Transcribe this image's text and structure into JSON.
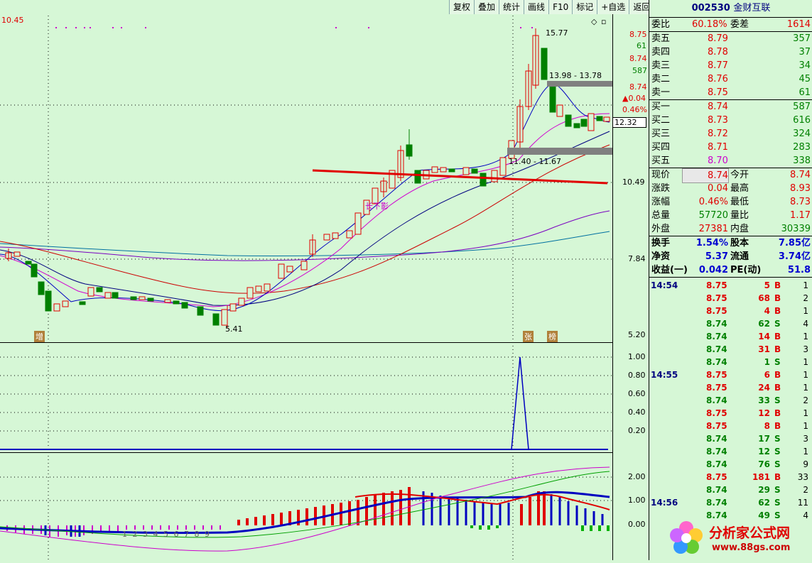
{
  "toolbar": {
    "buttons": [
      "复权",
      "叠加",
      "统计",
      "画线",
      "F10",
      "标记",
      "+自选",
      "返回"
    ]
  },
  "chart": {
    "top_price": "10.45",
    "high_label": "15.77",
    "low_label": "5.41",
    "zone_label_1": "13.98 - 13.78",
    "zone_label_2": "11.40 - 11.67",
    "annotation": "长下影",
    "marker_1": "增",
    "marker_2": "张",
    "marker_3": "榜",
    "axis_main": [
      "10.49",
      "7.84",
      "5.20"
    ],
    "axis_right_top": [
      "8.75",
      "61",
      "8.74",
      "587",
      "8.74",
      "▲0.04",
      "0.46%"
    ],
    "cursor_value": "12.32",
    "axis_mid": [
      "1.00",
      "0.80",
      "0.60",
      "0.40",
      "0.20"
    ],
    "axis_low": [
      "2.00",
      "1.00",
      "0.00"
    ],
    "bottom_digits": "1 2 3 4 5 6 7 8 9"
  },
  "panel": {
    "code": "002530",
    "name": "金财互联",
    "weibi": {
      "label": "委比",
      "value": "60.18%",
      "label2": "委差",
      "value2": "1614"
    },
    "sell": [
      {
        "label": "卖五",
        "price": "8.79",
        "vol": "357"
      },
      {
        "label": "卖四",
        "price": "8.78",
        "vol": "37"
      },
      {
        "label": "卖三",
        "price": "8.77",
        "vol": "34"
      },
      {
        "label": "卖二",
        "price": "8.76",
        "vol": "45"
      },
      {
        "label": "卖一",
        "price": "8.75",
        "vol": "61"
      }
    ],
    "buy": [
      {
        "label": "买一",
        "price": "8.74",
        "vol": "587"
      },
      {
        "label": "买二",
        "price": "8.73",
        "vol": "616"
      },
      {
        "label": "买三",
        "price": "8.72",
        "vol": "324"
      },
      {
        "label": "买四",
        "price": "8.71",
        "vol": "283"
      },
      {
        "label": "买五",
        "price": "8.70",
        "vol": "338"
      }
    ],
    "stats": [
      {
        "l1": "现价",
        "v1": "8.74",
        "l2": "今开",
        "v2": "8.74"
      },
      {
        "l1": "涨跌",
        "v1": "0.04",
        "l2": "最高",
        "v2": "8.93"
      },
      {
        "l1": "涨幅",
        "v1": "0.46%",
        "l2": "最低",
        "v2": "8.73"
      },
      {
        "l1": "总量",
        "v1": "57720",
        "l2": "量比",
        "v2": "1.17"
      },
      {
        "l1": "外盘",
        "v1": "27381",
        "l2": "内盘",
        "v2": "30339"
      }
    ],
    "stats2": [
      {
        "l1": "换手",
        "v1": "1.54%",
        "l2": "股本",
        "v2": "7.85亿"
      },
      {
        "l1": "净资",
        "v1": "5.37",
        "l2": "流通",
        "v2": "3.74亿"
      },
      {
        "l1": "收益(一)",
        "v1": "0.042",
        "l2": "PE(动)",
        "v2": "51.8"
      }
    ],
    "ticks": [
      {
        "t": "14:54",
        "p": "8.75",
        "v": "5",
        "s": "B",
        "n": "1"
      },
      {
        "t": "",
        "p": "8.75",
        "v": "68",
        "s": "B",
        "n": "2"
      },
      {
        "t": "",
        "p": "8.75",
        "v": "4",
        "s": "B",
        "n": "1"
      },
      {
        "t": "",
        "p": "8.74",
        "v": "62",
        "s": "S",
        "n": "4"
      },
      {
        "t": "",
        "p": "8.74",
        "v": "14",
        "s": "B",
        "n": "1"
      },
      {
        "t": "",
        "p": "8.74",
        "v": "31",
        "s": "B",
        "n": "3"
      },
      {
        "t": "",
        "p": "8.74",
        "v": "1",
        "s": "S",
        "n": "1"
      },
      {
        "t": "14:55",
        "p": "8.75",
        "v": "6",
        "s": "B",
        "n": "1"
      },
      {
        "t": "",
        "p": "8.75",
        "v": "24",
        "s": "B",
        "n": "1"
      },
      {
        "t": "",
        "p": "8.74",
        "v": "33",
        "s": "S",
        "n": "2"
      },
      {
        "t": "",
        "p": "8.75",
        "v": "12",
        "s": "B",
        "n": "1"
      },
      {
        "t": "",
        "p": "8.75",
        "v": "8",
        "s": "B",
        "n": "1"
      },
      {
        "t": "",
        "p": "8.74",
        "v": "17",
        "s": "S",
        "n": "3"
      },
      {
        "t": "",
        "p": "8.74",
        "v": "12",
        "s": "S",
        "n": "1"
      },
      {
        "t": "",
        "p": "8.74",
        "v": "76",
        "s": "S",
        "n": "9"
      },
      {
        "t": "",
        "p": "8.75",
        "v": "181",
        "s": "B",
        "n": "33"
      },
      {
        "t": "",
        "p": "8.74",
        "v": "29",
        "s": "S",
        "n": "2"
      },
      {
        "t": "14:56",
        "p": "8.74",
        "v": "62",
        "s": "S",
        "n": "11"
      },
      {
        "t": "",
        "p": "8.74",
        "v": "49",
        "s": "S",
        "n": "4"
      }
    ]
  },
  "logo": {
    "line1": "分析家公式网",
    "line2": "www.88gs.com"
  },
  "colors": {
    "up": "#e00000",
    "down": "#008000",
    "bg": "#d6f7d6"
  }
}
